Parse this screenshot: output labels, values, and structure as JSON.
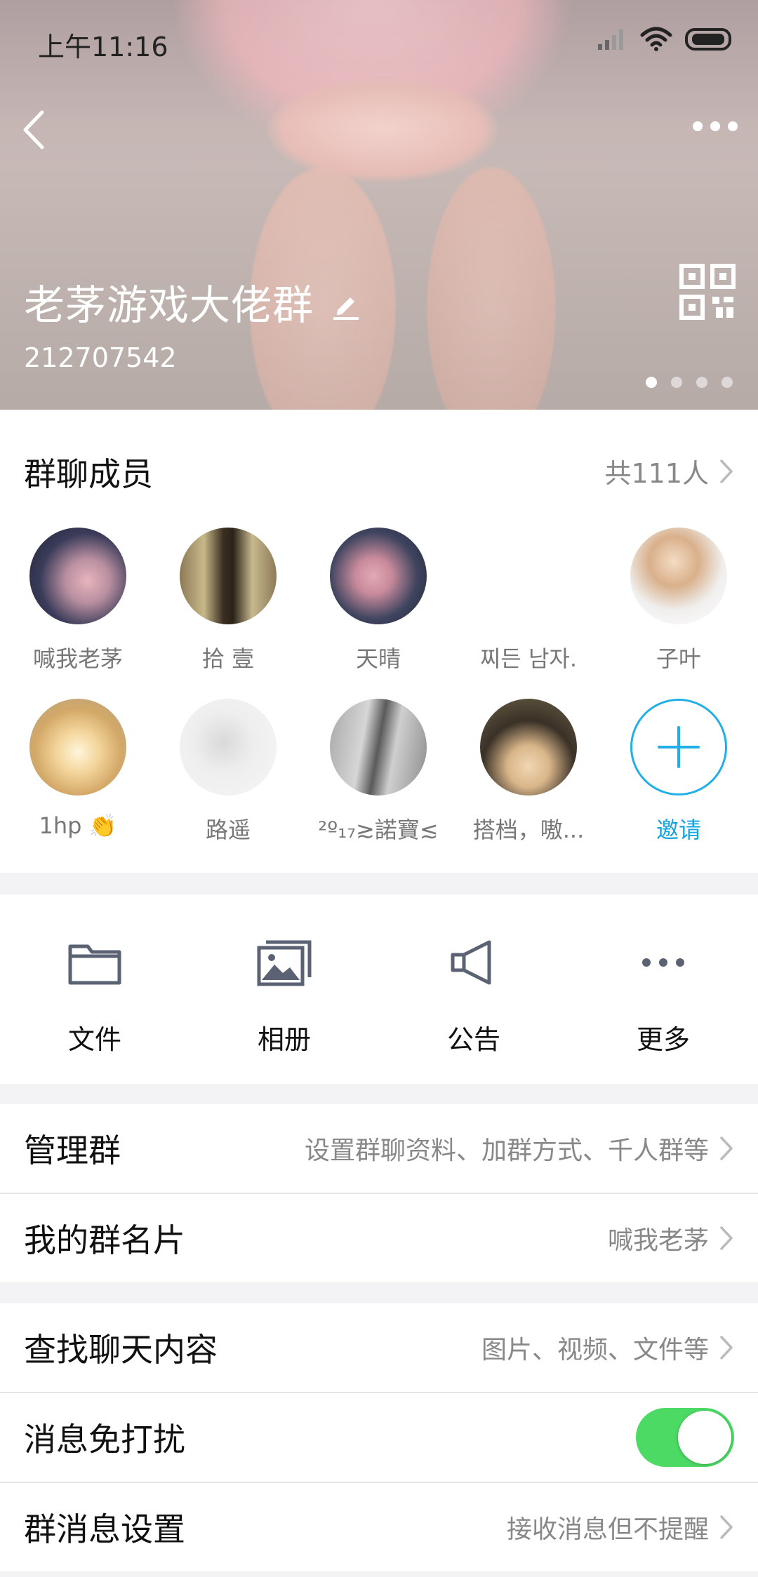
{
  "status_bar": {
    "time": "上午11:16"
  },
  "group": {
    "name": "老茅游戏大佬群",
    "id": "212707542",
    "carousel_pages": 4,
    "carousel_active": 1
  },
  "members_section": {
    "title": "群聊成员",
    "count": "共111人",
    "members": [
      {
        "name": "喊我老茅"
      },
      {
        "name": "拾 壹"
      },
      {
        "name": "天晴"
      },
      {
        "name": "찌든 남자."
      },
      {
        "name": "子叶"
      },
      {
        "name": "1hp 👏"
      },
      {
        "name": "路遥"
      },
      {
        "name": "²º₁₇≳諾寶≲"
      },
      {
        "name": "搭档，嗷..."
      }
    ],
    "invite_label": "邀请"
  },
  "actions": [
    {
      "label": "文件",
      "icon": "folder-icon"
    },
    {
      "label": "相册",
      "icon": "album-icon"
    },
    {
      "label": "公告",
      "icon": "megaphone-icon"
    },
    {
      "label": "更多",
      "icon": "more-dots-icon"
    }
  ],
  "settings": {
    "manage": {
      "title": "管理群",
      "value": "设置群聊资料、加群方式、千人群等"
    },
    "card": {
      "title": "我的群名片",
      "value": "喊我老茅"
    },
    "search": {
      "title": "查找聊天内容",
      "value": "图片、视频、文件等"
    },
    "mute": {
      "title": "消息免打扰",
      "enabled": true
    },
    "msg": {
      "title": "群消息设置",
      "value": "接收消息但不提醒"
    }
  },
  "colors": {
    "accent": "#12a3e0",
    "toggle_on": "#4cd964"
  }
}
